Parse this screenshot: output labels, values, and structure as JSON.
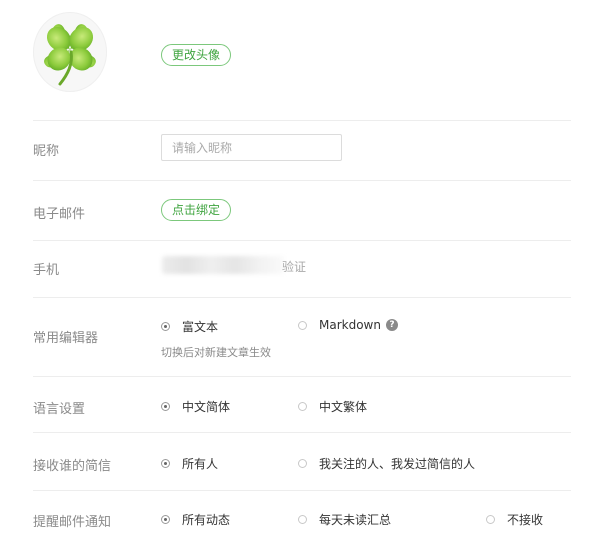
{
  "avatar": {
    "change_button": "更改头像"
  },
  "nickname": {
    "label": "昵称",
    "placeholder": "请输入昵称"
  },
  "email": {
    "label": "电子邮件",
    "bind_button": "点击绑定"
  },
  "phone": {
    "label": "手机",
    "suffix": "验证"
  },
  "editor": {
    "label": "常用编辑器",
    "options": [
      "富文本",
      "Markdown"
    ],
    "selected": "富文本",
    "hint": "切换后对新建文章生效",
    "help": "?"
  },
  "language": {
    "label": "语言设置",
    "options": [
      "中文简体",
      "中文繁体"
    ],
    "selected": "中文简体"
  },
  "messages": {
    "label": "接收谁的简信",
    "options": [
      "所有人",
      "我关注的人、我发过简信的人"
    ],
    "selected": "所有人"
  },
  "notify": {
    "label": "提醒邮件通知",
    "options": [
      "所有动态",
      "每天未读汇总",
      "不接收"
    ],
    "selected": "所有动态"
  },
  "colors": {
    "accent": "#3fa43f",
    "accent_border": "#7cc87c",
    "label": "#8a8a8a"
  }
}
